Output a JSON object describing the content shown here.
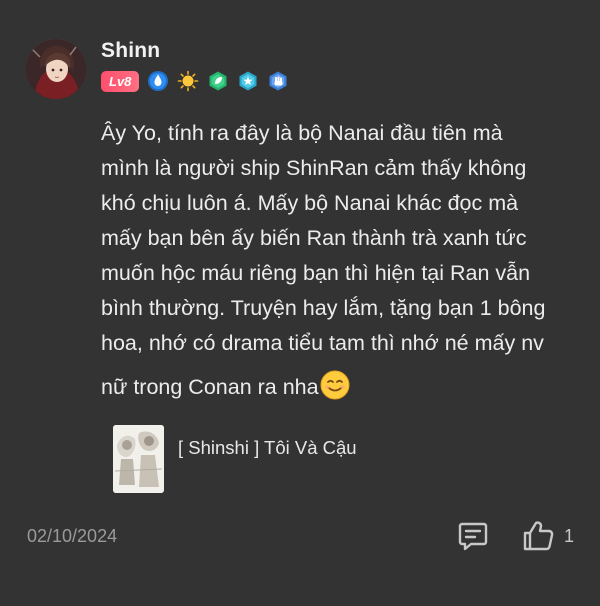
{
  "comment": {
    "username": "Shinn",
    "level": "Lv8",
    "badge_icons": [
      "drop-medal-icon",
      "sun-medal-icon",
      "leaf-medal-icon",
      "star-medal-icon",
      "hand-medal-icon"
    ],
    "text_lines": [
      "Ây Yo, tính ra đây là bộ Nanai đầu tiên mà",
      "mình là người ship ShinRan cảm thấy không",
      "khó chịu luôn á. Mấy bộ Nanai khác đọc mà",
      "mấy bạn bên ấy biến Ran thành trà xanh tức",
      "muốn hộc máu riêng bạn thì hiện tại Ran vẫn",
      "bình thường. Truyện hay lắm, tặng bạn 1 bông",
      "hoa, nhớ có drama tiểu tam thì nhớ né mấy nv",
      "nữ trong Conan ra nha"
    ],
    "emoji": "smiling-face-icon",
    "story": {
      "title": "[ Shinshi ] Tôi Và Cậu"
    },
    "date": "02/10/2024",
    "like_count": "1"
  },
  "colors": {
    "background": "#333333",
    "text": "#ececec",
    "muted": "#9a9a9a",
    "level_badge": "#ff5a72"
  }
}
